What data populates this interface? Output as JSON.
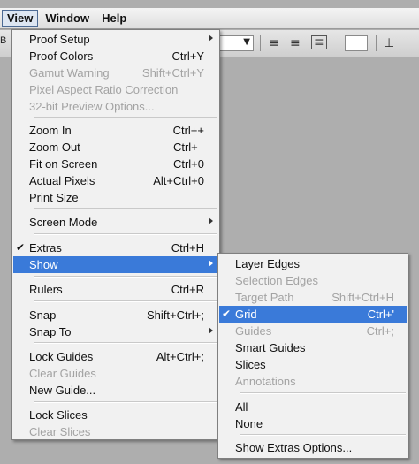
{
  "menubar": {
    "items": [
      "View",
      "Window",
      "Help"
    ]
  },
  "toolbar": {
    "partial_text": "B"
  },
  "view_menu": {
    "items": [
      {
        "label": "Proof Setup",
        "submenu": true
      },
      {
        "label": "Proof Colors",
        "shortcut": "Ctrl+Y"
      },
      {
        "label": "Gamut Warning",
        "shortcut": "Shift+Ctrl+Y",
        "disabled": true
      },
      {
        "label": "Pixel Aspect Ratio Correction",
        "disabled": true
      },
      {
        "label": "32-bit Preview Options...",
        "disabled": true
      },
      {
        "label": "Zoom In",
        "shortcut": "Ctrl++"
      },
      {
        "label": "Zoom Out",
        "shortcut": "Ctrl+–"
      },
      {
        "label": "Fit on Screen",
        "shortcut": "Ctrl+0"
      },
      {
        "label": "Actual Pixels",
        "shortcut": "Alt+Ctrl+0"
      },
      {
        "label": "Print Size"
      },
      {
        "label": "Screen Mode",
        "submenu": true
      },
      {
        "label": "Extras",
        "shortcut": "Ctrl+H",
        "checked": true
      },
      {
        "label": "Show",
        "submenu": true,
        "highlighted": true
      },
      {
        "label": "Rulers",
        "shortcut": "Ctrl+R"
      },
      {
        "label": "Snap",
        "shortcut": "Shift+Ctrl+;"
      },
      {
        "label": "Snap To",
        "submenu": true
      },
      {
        "label": "Lock Guides",
        "shortcut": "Alt+Ctrl+;"
      },
      {
        "label": "Clear Guides",
        "disabled": true
      },
      {
        "label": "New Guide..."
      },
      {
        "label": "Lock Slices"
      },
      {
        "label": "Clear Slices",
        "disabled": true
      }
    ]
  },
  "show_submenu": {
    "items": [
      {
        "label": "Layer Edges"
      },
      {
        "label": "Selection Edges",
        "disabled": true
      },
      {
        "label": "Target Path",
        "shortcut": "Shift+Ctrl+H",
        "disabled": true
      },
      {
        "label": "Grid",
        "shortcut": "Ctrl+'",
        "checked": true,
        "highlighted": true
      },
      {
        "label": "Guides",
        "shortcut": "Ctrl+;",
        "disabled": true
      },
      {
        "label": "Smart Guides"
      },
      {
        "label": "Slices"
      },
      {
        "label": "Annotations",
        "disabled": true
      },
      {
        "label": "All"
      },
      {
        "label": "None"
      },
      {
        "label": "Show Extras Options..."
      }
    ]
  },
  "icons": {
    "check": "checkmark-icon",
    "submenu": "submenu-arrow-icon"
  }
}
